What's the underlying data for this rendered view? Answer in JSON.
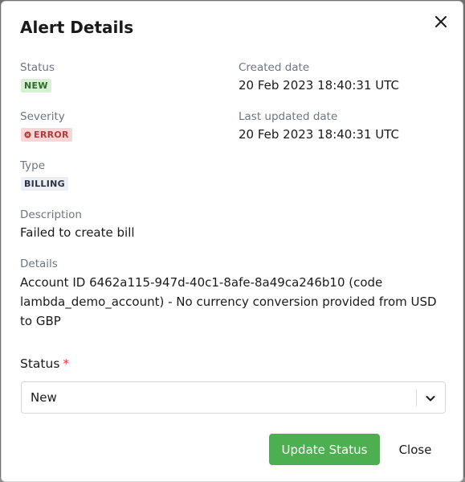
{
  "modal": {
    "title": "Alert Details",
    "close_icon": "close-icon"
  },
  "fields": {
    "status": {
      "label": "Status",
      "value": "NEW"
    },
    "created": {
      "label": "Created date",
      "value": "20 Feb 2023 18:40:31 UTC"
    },
    "severity": {
      "label": "Severity",
      "value": "ERROR",
      "icon": "x-circle-icon"
    },
    "updated": {
      "label": "Last updated date",
      "value": "20 Feb 2023 18:40:31 UTC"
    },
    "type": {
      "label": "Type",
      "value": "BILLING"
    },
    "description": {
      "label": "Description",
      "value": "Failed to create bill"
    },
    "details": {
      "label": "Details",
      "value": "Account ID 6462a115-947d-40c1-8afe-8a49ca246b10 (code lambda_demo_account) - No currency conversion provided from USD to GBP"
    }
  },
  "form": {
    "status_label": "Status",
    "required_marker": "*",
    "status_selected": "New",
    "chevron_icon": "chevron-down-icon"
  },
  "actions": {
    "update_label": "Update Status",
    "close_label": "Close"
  },
  "colors": {
    "primary_button": "#4caf50",
    "badge_new_bg": "#d7f0d3",
    "badge_error_bg": "#f9d6d6",
    "badge_type_bg": "#eceff3",
    "required": "#d63838"
  }
}
